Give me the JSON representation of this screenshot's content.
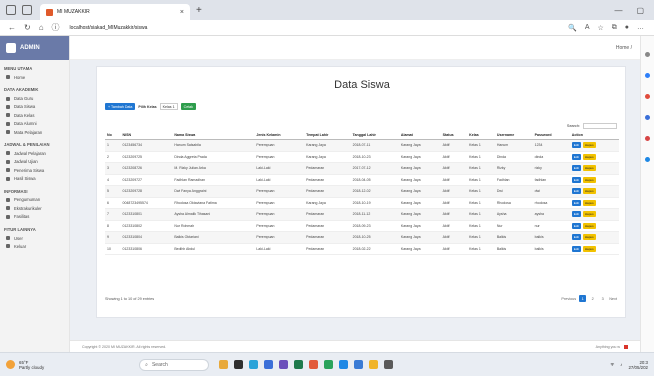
{
  "browser": {
    "tab_title": "MI MUZAKKIR",
    "url": "localhost/siakad_MIMuzakkir/siswa"
  },
  "sidebar": {
    "brand": "ADMIN",
    "sections": [
      {
        "title": "MENU UTAMA",
        "items": [
          "Home"
        ]
      },
      {
        "title": "DATA AKADEMIK",
        "items": [
          "Data Guru",
          "Data Siswa",
          "Data Kelas",
          "Data Alumni",
          "Mata Pelajaran"
        ]
      },
      {
        "title": "JADWAL & PENILAIAN",
        "items": [
          "Jadwal Pelajaran",
          "Jadwal Ujian",
          "Penerima Siswa",
          "Hasil Siswa"
        ]
      },
      {
        "title": "INFORMASI",
        "items": [
          "Pengumuman",
          "Ekstrakurikuler",
          "Fasilitas"
        ]
      },
      {
        "title": "FITUR LAINNYA",
        "items": [
          "User",
          "Keluar"
        ]
      }
    ]
  },
  "topbar": {
    "user": "Home /"
  },
  "page": {
    "title": "Data Siswa"
  },
  "toolbar": {
    "add_label": "+ Tambah Data",
    "filter_label": "Pilih Kelas",
    "class_value": "Kelas 1",
    "submit_label": "Cetak"
  },
  "search": {
    "label": "Search:"
  },
  "table": {
    "headers": [
      "No",
      "NISN",
      "Nama Siswa",
      "Jenis Kelamin",
      "Tempat Lahir",
      "Tanggal Lahir",
      "Alamat",
      "Status",
      "Kelas",
      "Username",
      "Password",
      "Action"
    ],
    "edit_label": "Edit",
    "delete_label": "Hapus",
    "rows": [
      [
        "1",
        "0123456734",
        "Hanum Salsabila",
        "Perempuan",
        "Karang Jaya",
        "2018-07-11",
        "Karang Jaya",
        "Aktif",
        "Kelas 1",
        "Hanum",
        "1234"
      ],
      [
        "2",
        "0123209725",
        "Dinda Aggreta Prada",
        "Perempuan",
        "Karang Jaya",
        "2018-10-23",
        "Karang Jaya",
        "Aktif",
        "Kelas 1",
        "Dinda",
        "dinda"
      ],
      [
        "3",
        "0123208726",
        "M. Rizky Julian Arka",
        "Laki-Laki",
        "Pedamaran",
        "2017-07-12",
        "Karang Jaya",
        "Aktif",
        "Kelas 1",
        "Rizky",
        "rizky"
      ],
      [
        "4",
        "0123209727",
        "Fadhlan Ramadhan",
        "Laki-Laki",
        "Pedamaran",
        "2018-04-05",
        "Karang Jaya",
        "Aktif",
        "Kelas 1",
        "Fadhlan",
        "fadhlan"
      ],
      [
        "5",
        "0123209728",
        "Dwi Fanya Anggraini",
        "Perempuan",
        "Pedamaran",
        "2018-12-02",
        "Karang Jaya",
        "Aktif",
        "Kelas 1",
        "Dwi",
        "dwi"
      ],
      [
        "6",
        "0048723495574",
        "Rhodosa Oktaviana Fatima",
        "Perempuan",
        "Karang Jaya",
        "2018-10-19",
        "Karang Jaya",
        "Aktif",
        "Kelas 1",
        "Rhodosa",
        "rhodosa"
      ],
      [
        "7",
        "0123310801",
        "Aysha Almalik Tihasani",
        "Perempuan",
        "Pedamaran",
        "2018-11-12",
        "Karang Jaya",
        "Aktif",
        "Kelas 1",
        "Aysha",
        "aysha"
      ],
      [
        "8",
        "0123310802",
        "Nur Rohmah",
        "Perempuan",
        "Pedamaran",
        "2018-09-23",
        "Karang Jaya",
        "Aktif",
        "Kelas 1",
        "Nur",
        "nur"
      ],
      [
        "9",
        "0123310804",
        "Balkis Oktariani",
        "Perempuan",
        "Pedamaran",
        "2018-10-25",
        "Karang Jaya",
        "Aktif",
        "Kelas 1",
        "Balkis",
        "balkis"
      ],
      [
        "10",
        "0123310806",
        "Bedihh Abdul",
        "Laki-Laki",
        "Pedamaran",
        "2018-02-22",
        "Karang Jaya",
        "Aktif",
        "Kelas 1",
        "Balkis",
        "balkis"
      ]
    ]
  },
  "pagination": {
    "showing": "Showing 1 to 10 of 29 entries",
    "previous": "Previous",
    "pages": [
      "1",
      "2",
      "3"
    ],
    "next": "Next"
  },
  "footer": {
    "copyright": "Copyright © 2020 MI MUZAKKIR. All rights reserved.",
    "right": "Anything you w"
  },
  "taskbar": {
    "temp": "65°F",
    "weather": "Partly cloudy",
    "search": "Search",
    "time": "20:3",
    "date": "27/05/202"
  }
}
